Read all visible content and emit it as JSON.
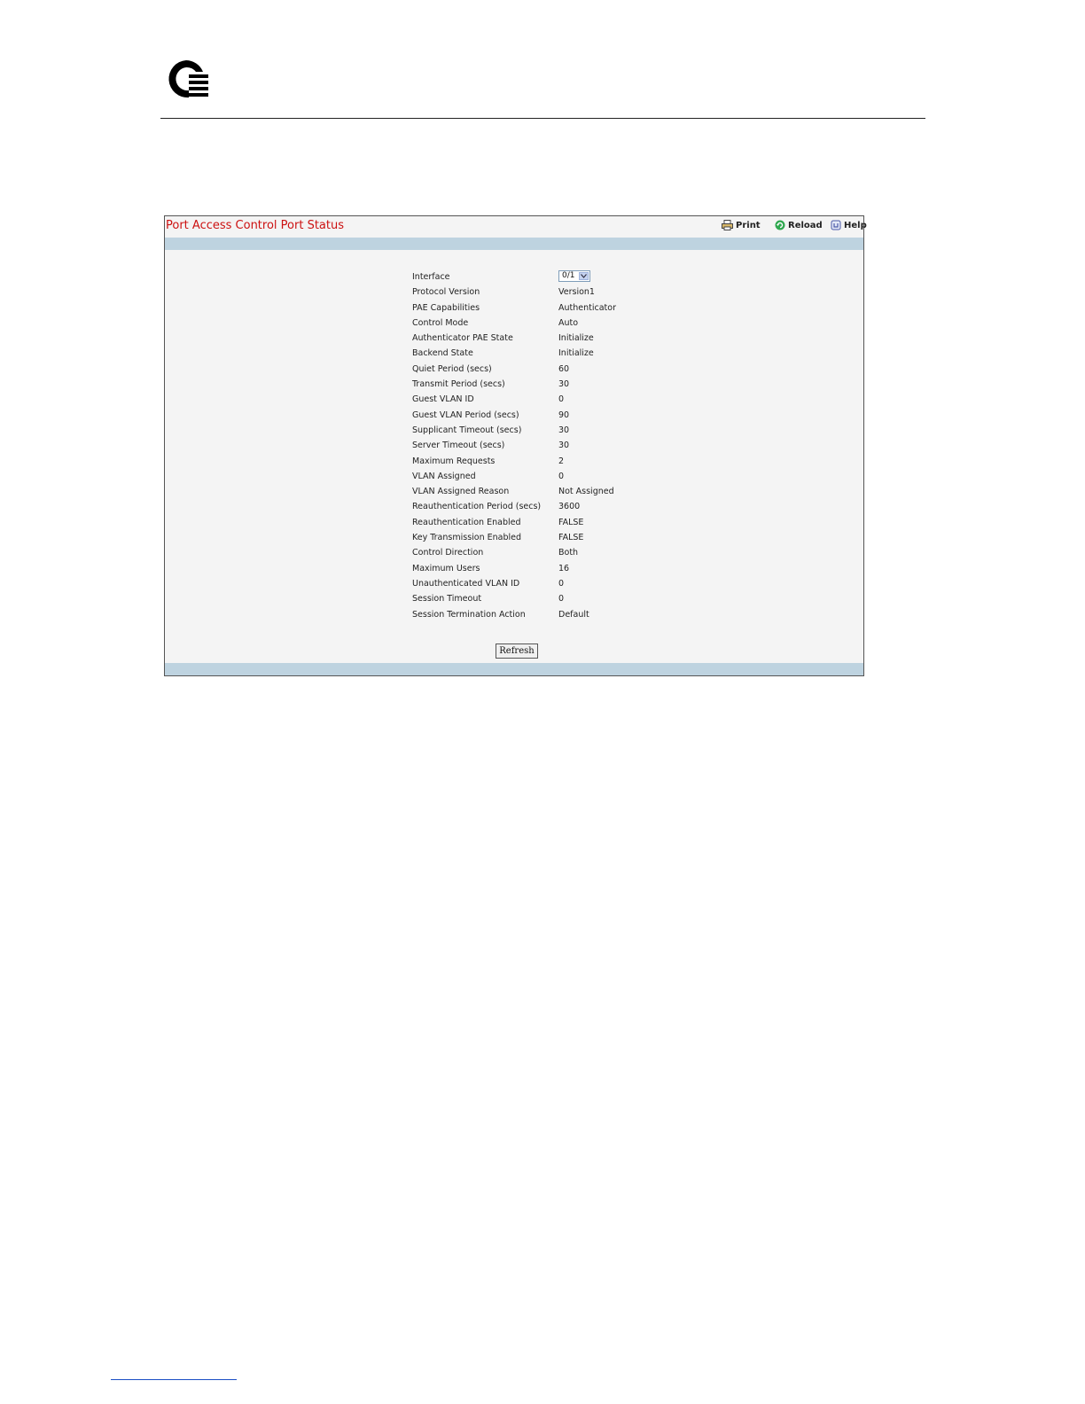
{
  "panel": {
    "title": "Port Access Control Port Status",
    "toolbar": {
      "print": "Print",
      "reload": "Reload",
      "help": "Help"
    }
  },
  "interface": {
    "label": "Interface",
    "selected": "0/1"
  },
  "fields": [
    {
      "label": "Protocol Version",
      "value": "Version1"
    },
    {
      "label": "PAE Capabilities",
      "value": "Authenticator"
    },
    {
      "label": "Control Mode",
      "value": "Auto"
    },
    {
      "label": "Authenticator PAE State",
      "value": "Initialize"
    },
    {
      "label": "Backend State",
      "value": "Initialize"
    },
    {
      "label": "Quiet Period (secs)",
      "value": "60"
    },
    {
      "label": "Transmit Period (secs)",
      "value": "30"
    },
    {
      "label": "Guest VLAN ID",
      "value": "0"
    },
    {
      "label": "Guest VLAN Period (secs)",
      "value": "90"
    },
    {
      "label": "Supplicant Timeout (secs)",
      "value": "30"
    },
    {
      "label": "Server Timeout (secs)",
      "value": "30"
    },
    {
      "label": "Maximum Requests",
      "value": "2"
    },
    {
      "label": "VLAN Assigned",
      "value": "0"
    },
    {
      "label": "VLAN Assigned Reason",
      "value": "Not Assigned"
    },
    {
      "label": "Reauthentication Period (secs)",
      "value": "3600"
    },
    {
      "label": "Reauthentication Enabled",
      "value": "FALSE"
    },
    {
      "label": "Key Transmission Enabled",
      "value": "FALSE"
    },
    {
      "label": "Control Direction",
      "value": "Both"
    },
    {
      "label": "Maximum Users",
      "value": "16"
    },
    {
      "label": "Unauthenticated VLAN ID",
      "value": "0"
    },
    {
      "label": "Session Timeout",
      "value": "0"
    },
    {
      "label": "Session Termination Action",
      "value": "Default"
    }
  ],
  "buttons": {
    "refresh": "Refresh"
  },
  "colors": {
    "title": "#cc1111",
    "band": "#bed3e0",
    "panel_bg": "#f4f4f4"
  },
  "icons": {
    "logo": "company-logo",
    "print": "printer-icon",
    "reload": "reload-icon",
    "help": "help-icon"
  }
}
